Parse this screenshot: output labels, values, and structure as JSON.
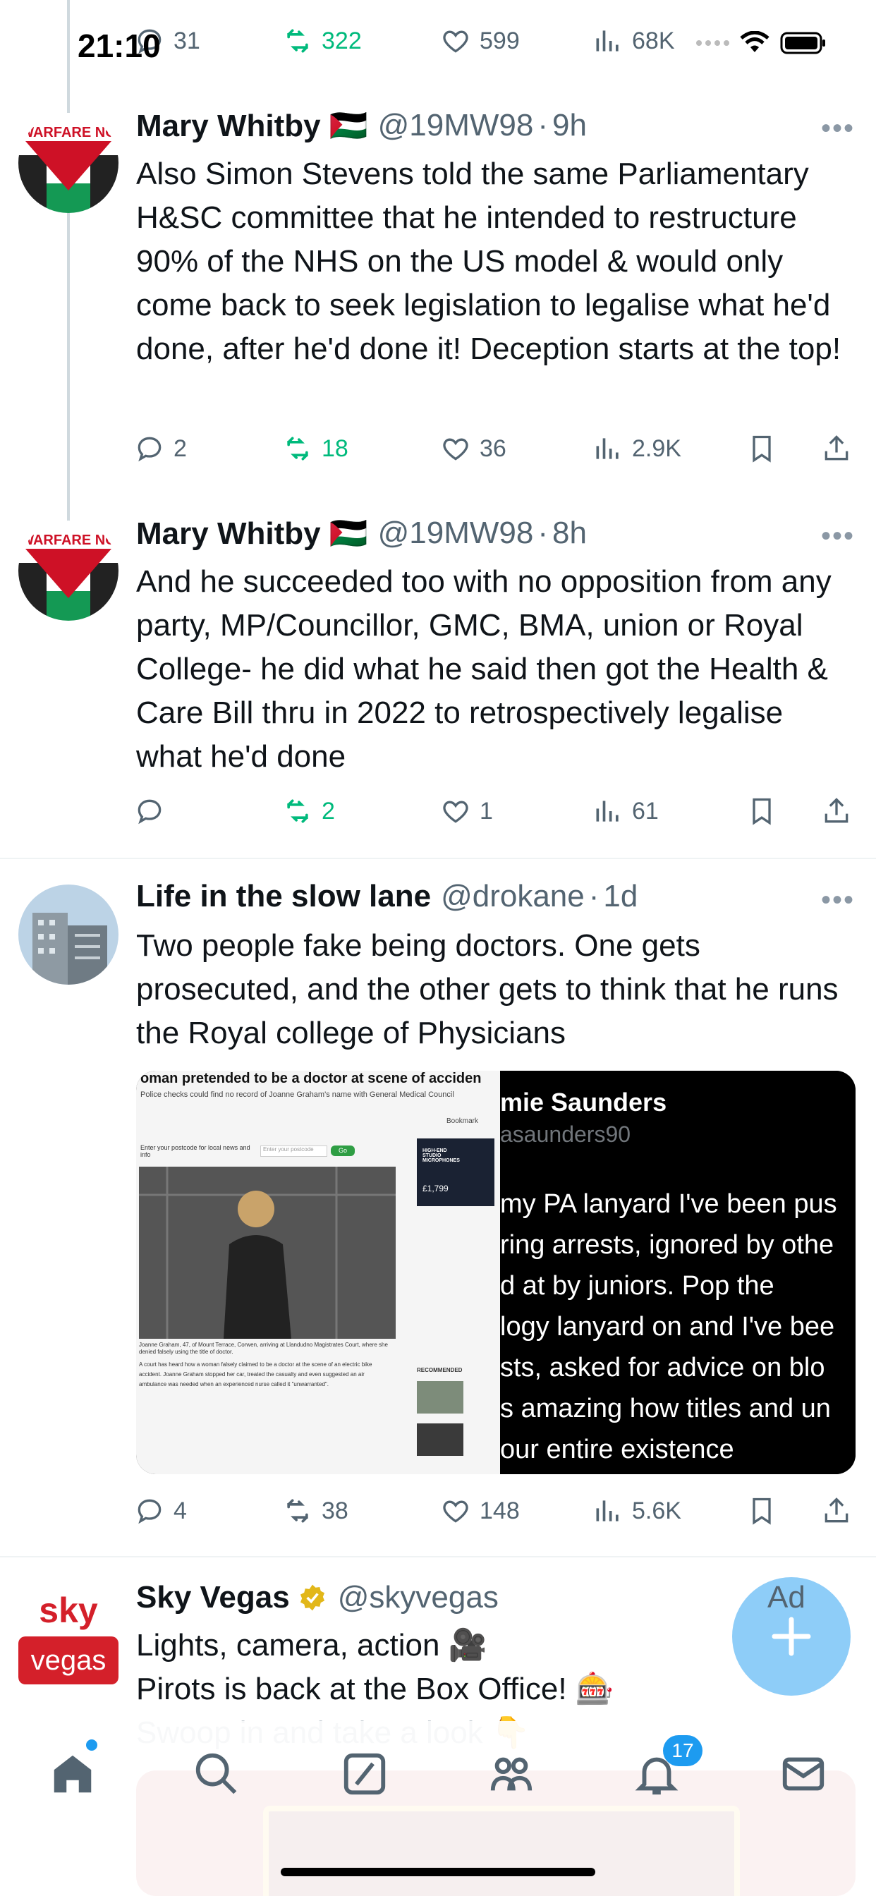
{
  "status_bar": {
    "time": "21:10"
  },
  "top_actions": {
    "replies": "31",
    "reposts": "322",
    "likes": "599",
    "views": "68K"
  },
  "tweets": [
    {
      "name": "Mary Whitby 🇵🇸",
      "handle": "@19MW98",
      "time": "9h",
      "avatar_text": "WARFARE NO",
      "text": "Also Simon Stevens told the same Parliamentary H&SC committee that he intended to restructure 90% of the NHS on the US model & would only come back to seek legislation to legalise what he'd done, after he'd done it! Deception starts at the top!",
      "replies": "2",
      "reposts": "18",
      "likes": "36",
      "views": "2.9K"
    },
    {
      "name": "Mary Whitby 🇵🇸",
      "handle": "@19MW98",
      "time": "8h",
      "avatar_text": "WARFARE NO",
      "text": "And he succeeded too with no opposition from any party, MP/Councillor, GMC, BMA, union or Royal College- he did what he said then got the Health & Care Bill thru in 2022 to retrospectively legalise what he'd done",
      "replies": "",
      "reposts": "2",
      "likes": "1",
      "views": "61"
    },
    {
      "name": "Life in the slow lane",
      "handle": "@drokane",
      "time": "1d",
      "text": "Two people fake being doctors. One gets prosecuted, and the other gets to think that he runs the Royal college of Physicians",
      "replies": "4",
      "reposts": "38",
      "likes": "148",
      "views": "5.6K",
      "media": {
        "left": {
          "headline": "oman pretended to be a doctor at scene of acciden",
          "subhead": "Police checks could find no record of Joanne Graham's name with General Medical Council",
          "bookmark": "Bookmark",
          "postcode_label": "Enter your postcode for local news and info",
          "postcode_placeholder": "Enter your postcode",
          "go": "Go",
          "ad_title": "HIGH-END STUDIO MICROPHONES",
          "ad_price": "£1,799",
          "caption": "Joanne Graham, 47, of Mount Terrace, Corwen, arriving at Llandudno Magistrates Court, where she denied falsely using the title of doctor.",
          "body": "A court has heard how a woman falsely claimed to be a doctor at the scene of an electric bike accident. Joanne Graham stopped her car, treated the casualty and even suggested an air ambulance was needed when an experienced nurse called it \"unwarranted\".",
          "recommended": "RECOMMENDED"
        },
        "right": {
          "name": "mie Saunders",
          "handle": "asaunders90",
          "lines": [
            "my PA lanyard I've been pus",
            "ring arrests, ignored by othe",
            "d at by juniors. Pop the",
            "logy lanyard on and I've bee",
            "sts, asked for advice on blo",
            "s amazing how titles and un",
            "our entire existence"
          ]
        }
      }
    },
    {
      "name": "Sky Vegas",
      "handle": "@skyvegas",
      "promoted": "Ad",
      "avatar_top": "sky",
      "avatar_bottom": "vegas",
      "lines": [
        "Lights, camera, action 🎥",
        "Pirots is back at the Box Office! 🎰",
        "Swoop in and take a look 👇"
      ]
    }
  ],
  "tab_bar": {
    "notifications_count": "17"
  },
  "colors": {
    "green": "#00ba7c",
    "blue": "#1d9bf0",
    "gray": "#536471",
    "fab": "#8ecdf8",
    "sky_red": "#d4202a"
  }
}
